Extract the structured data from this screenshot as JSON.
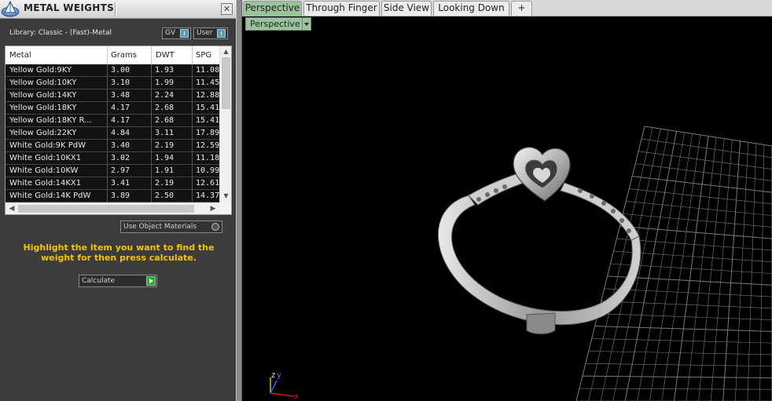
{
  "panel": {
    "title": "METAL WEIGHTS",
    "close_glyph": "✕",
    "library_label": "Library: Classic - (Fast)-Metal",
    "toggles": {
      "gv": "GV",
      "user": "User"
    },
    "use_object_materials": "Use Object Materials",
    "instructions": "Highlight the item you want to find the weight for then press calculate.",
    "calculate_label": "Calculate"
  },
  "table": {
    "columns": [
      "Metal",
      "Grams",
      "DWT",
      "SPG"
    ],
    "rows": [
      {
        "metal": "Yellow Gold:9KY",
        "grams": "3.00",
        "dwt": "1.93",
        "spg": "11.08"
      },
      {
        "metal": "Yellow Gold:10KY",
        "grams": "3.10",
        "dwt": "1.99",
        "spg": "11.45"
      },
      {
        "metal": "Yellow Gold:14KY",
        "grams": "3.48",
        "dwt": "2.24",
        "spg": "12.88"
      },
      {
        "metal": "Yellow Gold:18KY",
        "grams": "4.17",
        "dwt": "2.68",
        "spg": "15.41"
      },
      {
        "metal": "Yellow Gold:18KY R...",
        "grams": "4.17",
        "dwt": "2.68",
        "spg": "15.41"
      },
      {
        "metal": "Yellow Gold:22KY",
        "grams": "4.84",
        "dwt": "3.11",
        "spg": "17.89"
      },
      {
        "metal": "White Gold:9K PdW",
        "grams": "3.40",
        "dwt": "2.19",
        "spg": "12.59"
      },
      {
        "metal": "White Gold:10KX1",
        "grams": "3.02",
        "dwt": "1.94",
        "spg": "11.18"
      },
      {
        "metal": "White Gold:10KW",
        "grams": "2.97",
        "dwt": "1.91",
        "spg": "10.99"
      },
      {
        "metal": "White Gold:14KX1",
        "grams": "3.41",
        "dwt": "2.19",
        "spg": "12.61"
      },
      {
        "metal": "White Gold:14K PdW",
        "grams": "3.89",
        "dwt": "2.50",
        "spg": "14.37"
      }
    ]
  },
  "viewport": {
    "tabs": [
      "Perspective",
      "Through Finger",
      "Side View",
      "Looking Down"
    ],
    "add_tab_glyph": "+",
    "view_select": "Perspective",
    "axis": {
      "x": "x",
      "y": "y",
      "z": "z"
    }
  },
  "colors": {
    "instruction_text": "#f4c400",
    "active_tab": "#9bc29b",
    "viewport_bg": "#000000",
    "grid": "#7a7a7a"
  },
  "icons": {
    "logo": "pyramid-logo-icon",
    "close": "close-icon",
    "add_tab": "plus-icon",
    "calculate": "play-arrow-icon"
  }
}
